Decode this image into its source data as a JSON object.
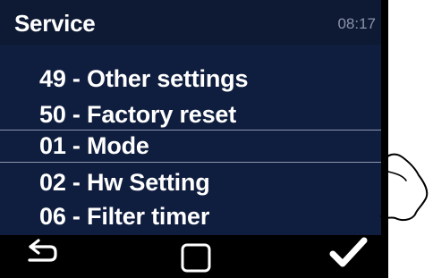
{
  "header": {
    "title": "Service",
    "time": "08:17"
  },
  "menu": {
    "items": [
      {
        "label": "49 - Other settings",
        "selected": false
      },
      {
        "label": "50 - Factory reset",
        "selected": false
      },
      {
        "label": "01 - Mode",
        "selected": true
      },
      {
        "label": "02 - Hw Setting",
        "selected": false
      },
      {
        "label": "06 - Filter timer",
        "selected": false
      }
    ]
  },
  "footer": {
    "back_icon": "back-arrow-icon",
    "home_icon": "square-home-icon",
    "confirm_icon": "checkmark-icon"
  },
  "colors": {
    "header_bg": "#0e1a33",
    "menu_bg": "#0f1d3e",
    "text": "#ffffff",
    "time_text": "#8a93a8",
    "selection_border": "#8d97ad"
  }
}
